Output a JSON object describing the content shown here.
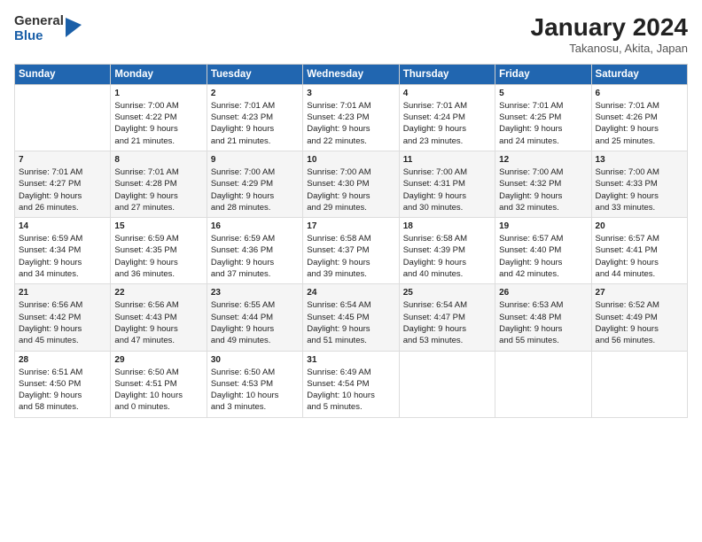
{
  "logo": {
    "general": "General",
    "blue": "Blue"
  },
  "title": "January 2024",
  "subtitle": "Takanosu, Akita, Japan",
  "days_of_week": [
    "Sunday",
    "Monday",
    "Tuesday",
    "Wednesday",
    "Thursday",
    "Friday",
    "Saturday"
  ],
  "weeks": [
    [
      {
        "day": "",
        "content": ""
      },
      {
        "day": "1",
        "content": "Sunrise: 7:00 AM\nSunset: 4:22 PM\nDaylight: 9 hours\nand 21 minutes."
      },
      {
        "day": "2",
        "content": "Sunrise: 7:01 AM\nSunset: 4:23 PM\nDaylight: 9 hours\nand 21 minutes."
      },
      {
        "day": "3",
        "content": "Sunrise: 7:01 AM\nSunset: 4:23 PM\nDaylight: 9 hours\nand 22 minutes."
      },
      {
        "day": "4",
        "content": "Sunrise: 7:01 AM\nSunset: 4:24 PM\nDaylight: 9 hours\nand 23 minutes."
      },
      {
        "day": "5",
        "content": "Sunrise: 7:01 AM\nSunset: 4:25 PM\nDaylight: 9 hours\nand 24 minutes."
      },
      {
        "day": "6",
        "content": "Sunrise: 7:01 AM\nSunset: 4:26 PM\nDaylight: 9 hours\nand 25 minutes."
      }
    ],
    [
      {
        "day": "7",
        "content": "Sunrise: 7:01 AM\nSunset: 4:27 PM\nDaylight: 9 hours\nand 26 minutes."
      },
      {
        "day": "8",
        "content": "Sunrise: 7:01 AM\nSunset: 4:28 PM\nDaylight: 9 hours\nand 27 minutes."
      },
      {
        "day": "9",
        "content": "Sunrise: 7:00 AM\nSunset: 4:29 PM\nDaylight: 9 hours\nand 28 minutes."
      },
      {
        "day": "10",
        "content": "Sunrise: 7:00 AM\nSunset: 4:30 PM\nDaylight: 9 hours\nand 29 minutes."
      },
      {
        "day": "11",
        "content": "Sunrise: 7:00 AM\nSunset: 4:31 PM\nDaylight: 9 hours\nand 30 minutes."
      },
      {
        "day": "12",
        "content": "Sunrise: 7:00 AM\nSunset: 4:32 PM\nDaylight: 9 hours\nand 32 minutes."
      },
      {
        "day": "13",
        "content": "Sunrise: 7:00 AM\nSunset: 4:33 PM\nDaylight: 9 hours\nand 33 minutes."
      }
    ],
    [
      {
        "day": "14",
        "content": "Sunrise: 6:59 AM\nSunset: 4:34 PM\nDaylight: 9 hours\nand 34 minutes."
      },
      {
        "day": "15",
        "content": "Sunrise: 6:59 AM\nSunset: 4:35 PM\nDaylight: 9 hours\nand 36 minutes."
      },
      {
        "day": "16",
        "content": "Sunrise: 6:59 AM\nSunset: 4:36 PM\nDaylight: 9 hours\nand 37 minutes."
      },
      {
        "day": "17",
        "content": "Sunrise: 6:58 AM\nSunset: 4:37 PM\nDaylight: 9 hours\nand 39 minutes."
      },
      {
        "day": "18",
        "content": "Sunrise: 6:58 AM\nSunset: 4:39 PM\nDaylight: 9 hours\nand 40 minutes."
      },
      {
        "day": "19",
        "content": "Sunrise: 6:57 AM\nSunset: 4:40 PM\nDaylight: 9 hours\nand 42 minutes."
      },
      {
        "day": "20",
        "content": "Sunrise: 6:57 AM\nSunset: 4:41 PM\nDaylight: 9 hours\nand 44 minutes."
      }
    ],
    [
      {
        "day": "21",
        "content": "Sunrise: 6:56 AM\nSunset: 4:42 PM\nDaylight: 9 hours\nand 45 minutes."
      },
      {
        "day": "22",
        "content": "Sunrise: 6:56 AM\nSunset: 4:43 PM\nDaylight: 9 hours\nand 47 minutes."
      },
      {
        "day": "23",
        "content": "Sunrise: 6:55 AM\nSunset: 4:44 PM\nDaylight: 9 hours\nand 49 minutes."
      },
      {
        "day": "24",
        "content": "Sunrise: 6:54 AM\nSunset: 4:45 PM\nDaylight: 9 hours\nand 51 minutes."
      },
      {
        "day": "25",
        "content": "Sunrise: 6:54 AM\nSunset: 4:47 PM\nDaylight: 9 hours\nand 53 minutes."
      },
      {
        "day": "26",
        "content": "Sunrise: 6:53 AM\nSunset: 4:48 PM\nDaylight: 9 hours\nand 55 minutes."
      },
      {
        "day": "27",
        "content": "Sunrise: 6:52 AM\nSunset: 4:49 PM\nDaylight: 9 hours\nand 56 minutes."
      }
    ],
    [
      {
        "day": "28",
        "content": "Sunrise: 6:51 AM\nSunset: 4:50 PM\nDaylight: 9 hours\nand 58 minutes."
      },
      {
        "day": "29",
        "content": "Sunrise: 6:50 AM\nSunset: 4:51 PM\nDaylight: 10 hours\nand 0 minutes."
      },
      {
        "day": "30",
        "content": "Sunrise: 6:50 AM\nSunset: 4:53 PM\nDaylight: 10 hours\nand 3 minutes."
      },
      {
        "day": "31",
        "content": "Sunrise: 6:49 AM\nSunset: 4:54 PM\nDaylight: 10 hours\nand 5 minutes."
      },
      {
        "day": "",
        "content": ""
      },
      {
        "day": "",
        "content": ""
      },
      {
        "day": "",
        "content": ""
      }
    ]
  ]
}
